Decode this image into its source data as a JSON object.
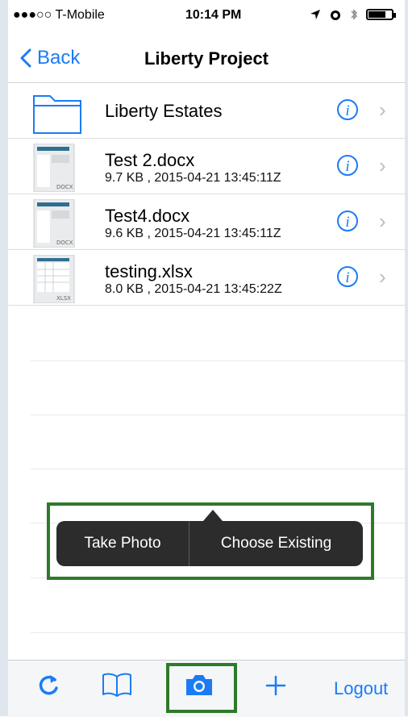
{
  "status": {
    "carrier": "●●●○○ T-Mobile",
    "time": "10:14 PM",
    "battery_level": 0.8
  },
  "nav": {
    "back_label": "Back",
    "title": "Liberty Project"
  },
  "items": [
    {
      "type": "folder",
      "name": "Liberty Estates",
      "meta": ""
    },
    {
      "type": "docx",
      "name": "Test 2.docx",
      "meta": "9.7 KB , 2015-04-21 13:45:11Z",
      "badge": "DOCX"
    },
    {
      "type": "docx",
      "name": "Test4.docx",
      "meta": "9.6 KB , 2015-04-21 13:45:11Z",
      "badge": "DOCX"
    },
    {
      "type": "xlsx",
      "name": "testing.xlsx",
      "meta": "8.0 KB , 2015-04-21 13:45:22Z",
      "badge": "XLSX"
    }
  ],
  "popup": {
    "take_photo": "Take Photo",
    "choose_existing": "Choose Existing"
  },
  "toolbar": {
    "logout": "Logout",
    "icons": [
      "refresh-icon",
      "bookmarks-icon",
      "camera-icon",
      "add-icon"
    ]
  },
  "colors": {
    "accent": "#1a7cf5",
    "highlight": "#2f7a2a",
    "popup_bg": "#2c2c2c"
  }
}
